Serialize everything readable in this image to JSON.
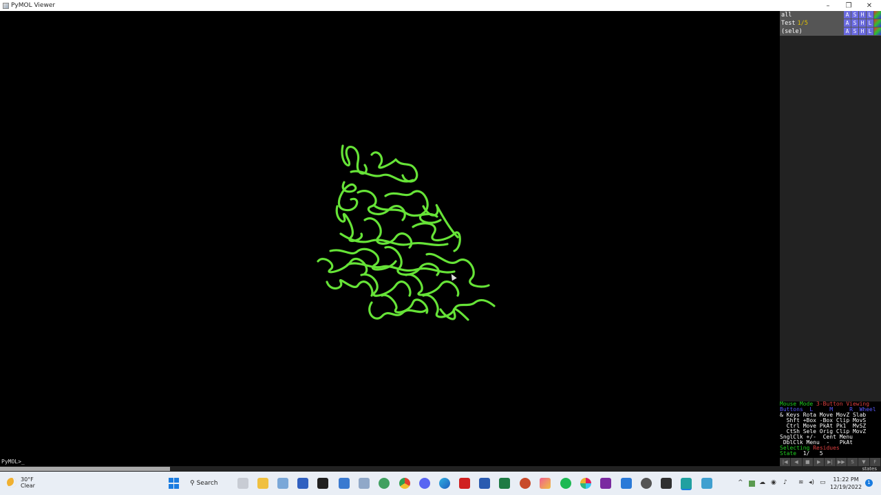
{
  "window": {
    "title": "PyMOL Viewer",
    "controls": [
      "–",
      "❐",
      "✕"
    ]
  },
  "objects": [
    {
      "name": "all",
      "states": "",
      "buttons": [
        "A",
        "S",
        "H",
        "L"
      ]
    },
    {
      "name": "Test",
      "states": "1/5",
      "buttons": [
        "A",
        "S",
        "H",
        "L"
      ]
    },
    {
      "name": "(sele)",
      "states": "",
      "buttons": [
        "A",
        "S",
        "H",
        "L"
      ]
    }
  ],
  "mouse_panel": {
    "mode_label": "Mouse Mode",
    "mode_value": "3-Button Viewing",
    "buttons_row": "Buttons  L     M     R  Wheel",
    "keys_row": "& Keys Rota Move MovZ Slab",
    "shft_row": "  Shft +Box -Box Clip MovS",
    "ctrl_row": "  Ctrl Move PkAt Pk1  MvSZ",
    "ctsh_row": "  CtSh Sele Orig Clip MovZ",
    "snglclk_row": "SnglClk +/-  Cent Menu",
    "dblclk_row": " DblClk Menu  -   PkAt",
    "selecting_label": "Selecting",
    "selecting_value": "Residues",
    "state_label": "State",
    "state_value": "  1/   5"
  },
  "movie_controls": [
    "|◀",
    "◀",
    "■",
    "▶",
    "▶|",
    "▶▶",
    "S",
    "▼",
    "F"
  ],
  "states_label": "states",
  "command_line": {
    "prompt": "PyMOL>_"
  },
  "colors": {
    "ribbon": "#6cf03a",
    "panel": "#555555",
    "accent_red": "#e04040",
    "accent_green": "#20d020"
  },
  "taskbar": {
    "weather_temp": "30°F",
    "weather_desc": "Clear",
    "search_label": "Search",
    "clock_time": "11:22 PM",
    "clock_date": "12/19/2022",
    "notification_count": "1",
    "pinned_icons": [
      "start",
      "search",
      "task-view",
      "file-explorer",
      "photos",
      "azure",
      "terminal",
      "store",
      "documents",
      "maps",
      "chrome",
      "discord",
      "edge",
      "acrobat",
      "word",
      "excel",
      "powerpoint",
      "paint",
      "spotify",
      "slack",
      "onenote",
      "todo",
      "github",
      "cmd",
      "pymol",
      "notepad"
    ]
  }
}
